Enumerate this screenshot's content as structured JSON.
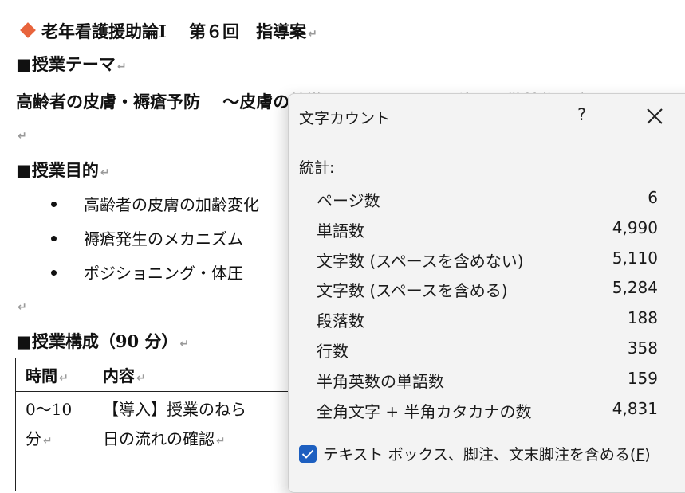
{
  "document": {
    "title": "老年看護援助論Ⅰ　 第６回　指導案",
    "section_theme": "■授業テーマ",
    "theme_text": "高齢者の皮膚・褥瘡予防　 ～皮膚の特徴とアセスメント・体圧分散技術の実",
    "section_purpose": "■授業目的",
    "bullets": [
      "高齢者の皮膚の加齢変化",
      "褥瘡発生のメカニズム",
      "ポジショニング・体圧"
    ],
    "section_structure": "■授業構成（90 分）",
    "table": {
      "headers": [
        "時間",
        "内容"
      ],
      "rows": [
        {
          "time_line1": "0～10",
          "time_line2": "分",
          "content_line1": "【導入】授業のねら",
          "content_line2": "日の流れの確認"
        }
      ]
    },
    "paragraph_mark": "↵"
  },
  "dialog": {
    "title": "文字カウント",
    "help": "?",
    "stats_label": "統計:",
    "stats": [
      {
        "label": "ページ数",
        "value": "6"
      },
      {
        "label": "単語数",
        "value": "4,990"
      },
      {
        "label": "文字数 (スペースを含めない)",
        "value": "5,110"
      },
      {
        "label": "文字数 (スペースを含める)",
        "value": "5,284"
      },
      {
        "label": "段落数",
        "value": "188"
      },
      {
        "label": "行数",
        "value": "358"
      },
      {
        "label": "半角英数の単語数",
        "value": "159"
      },
      {
        "label": "全角文字 + 半角カタカナの数",
        "value": "4,831"
      }
    ],
    "checkbox_label": "テキスト ボックス、脚注、文末脚注を含める(",
    "checkbox_accel": "F",
    "checkbox_end": ")",
    "checkbox_checked": true,
    "accent_color": "#1d5fc0"
  }
}
